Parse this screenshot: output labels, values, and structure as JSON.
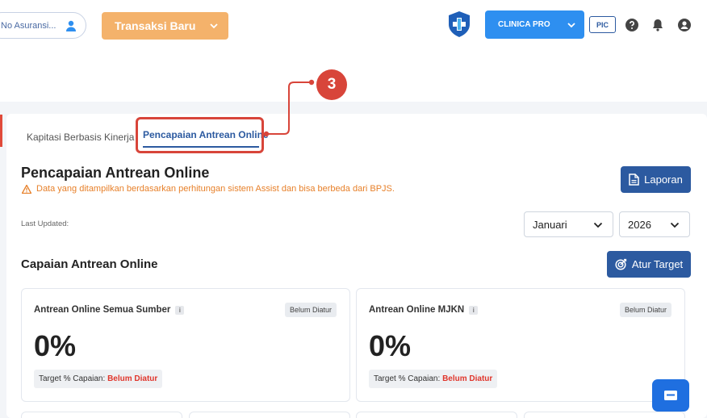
{
  "topbar": {
    "search_placeholder": "No Asuransi...",
    "transaksi_label": "Transaksi Baru",
    "clinic_label": "CLINICA PRO",
    "pic_label": "PIC"
  },
  "callout": {
    "number": "3"
  },
  "tabs": {
    "items": [
      {
        "label": "Kapitasi Berbasis Kinerja"
      },
      {
        "label": "Pencapaian Antrean Online"
      }
    ]
  },
  "header": {
    "title": "Pencapaian Antrean Online",
    "warning": "Data yang ditampilkan berdasarkan perhitungan sistem Assist dan bisa berbeda dari BPJS.",
    "laporan_label": "Laporan",
    "last_updated": "Last Updated:",
    "month": "Januari",
    "year": "2026"
  },
  "section": {
    "title": "Capaian Antrean Online",
    "atur_label": "Atur Target"
  },
  "cards": [
    {
      "title": "Antrean Online Semua Sumber",
      "info": "i",
      "status": "Belum Diatur",
      "value": "0%",
      "target_label": "Target % Capaian:",
      "target_value": "Belum Diatur"
    },
    {
      "title": "Antrean Online MJKN",
      "info": "i",
      "status": "Belum Diatur",
      "value": "0%",
      "target_label": "Target % Capaian:",
      "target_value": "Belum Diatur"
    }
  ],
  "colors": {
    "primary": "#2c5aa0",
    "accent_blue": "#2e8ff0",
    "orange": "#f4b26b",
    "warning": "#e7802a",
    "callout_red": "#d8453a"
  }
}
